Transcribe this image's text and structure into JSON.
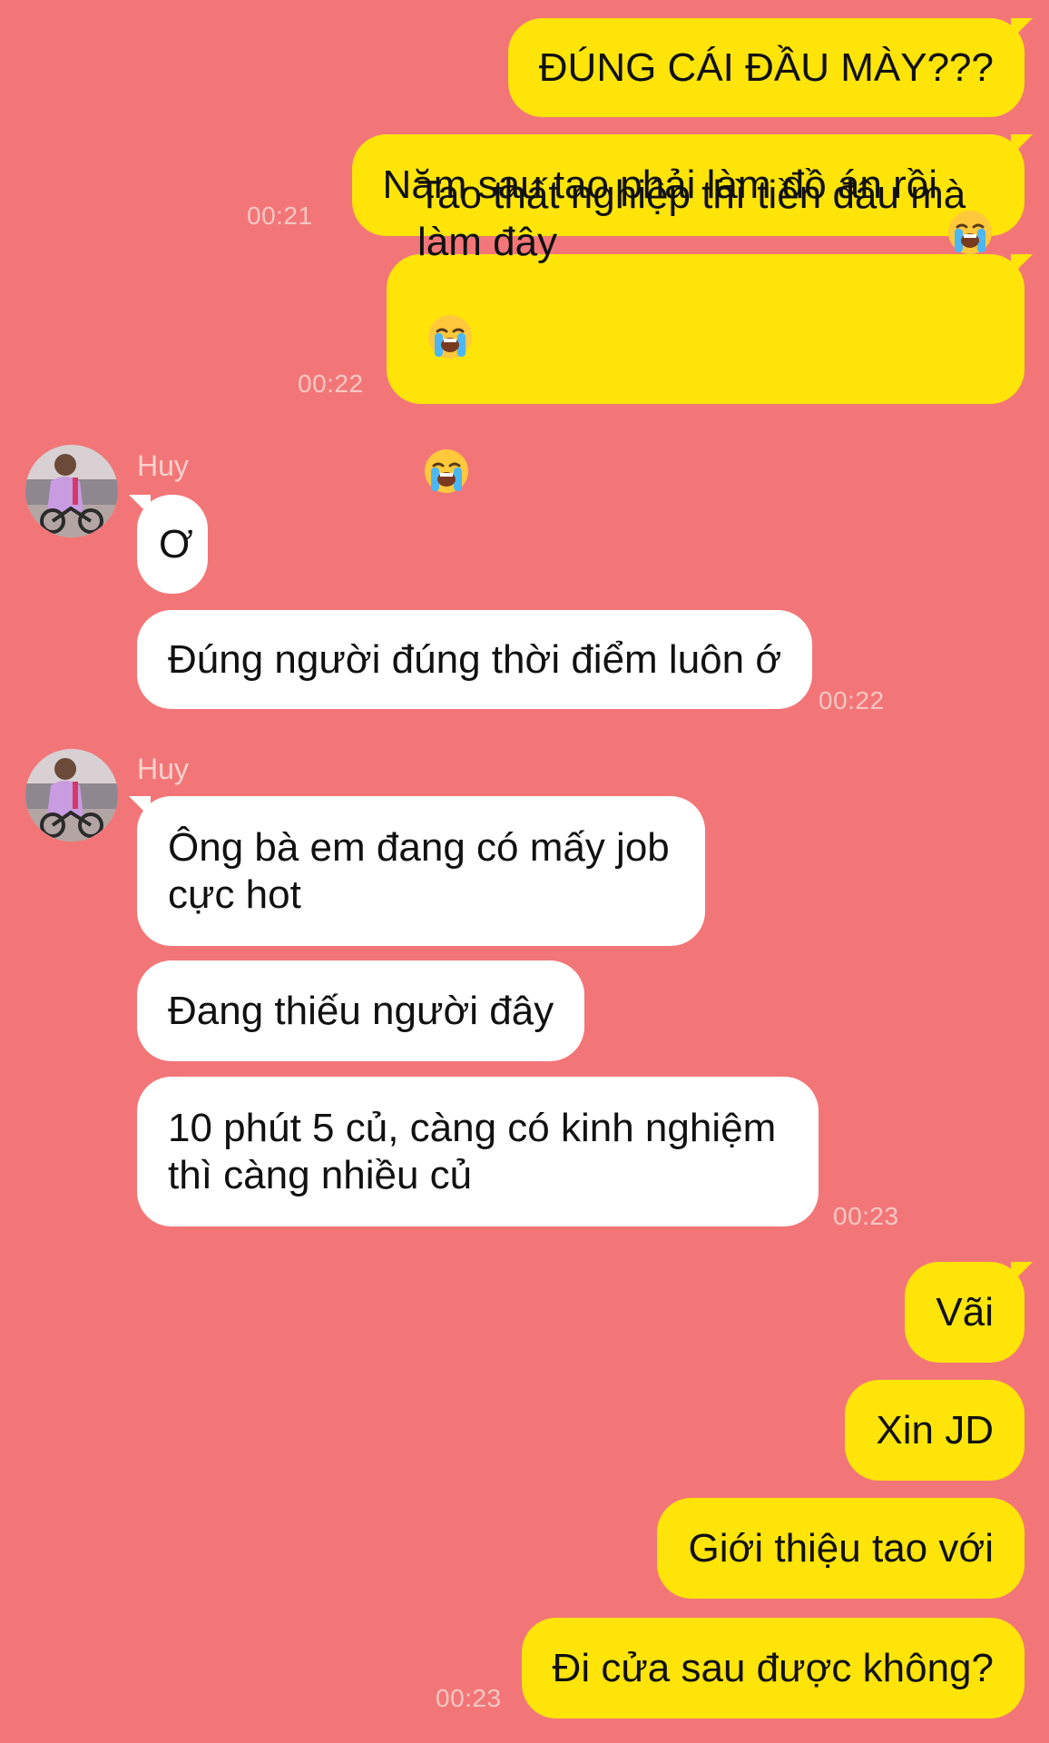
{
  "contact": {
    "name": "Huy"
  },
  "messages": {
    "m1": {
      "text": "ĐÚNG CÁI ĐẦU MÀY???"
    },
    "m2": {
      "text": "Năm sau tao phải làm đồ án rồi",
      "emoji": "loudly-crying-face",
      "time": "00:21"
    },
    "m3": {
      "text": "Tao thất nghiệp thì tiền đâu mà\nlàm đây",
      "emoji": "loudly-crying-face-x2",
      "time": "00:22"
    },
    "g1": {
      "sender": "Huy"
    },
    "m4": {
      "text": "Ơ"
    },
    "m5": {
      "text": "Đúng người đúng thời điểm luôn ớ",
      "time": "00:22"
    },
    "g2": {
      "sender": "Huy"
    },
    "m6": {
      "text": "Ông bà em đang có mấy job\ncực hot"
    },
    "m7": {
      "text": "Đang thiếu người đây"
    },
    "m8": {
      "text": "10 phút 5 củ, càng có kinh nghiệm\nthì càng nhiều củ",
      "time": "00:23"
    },
    "m9": {
      "text": "Vãi"
    },
    "m10": {
      "text": "Xin JD"
    },
    "m11": {
      "text": "Giới thiệu tao với"
    },
    "m12": {
      "text": "Đi cửa sau được không?",
      "time": "00:23"
    }
  },
  "colors": {
    "background": "#F27678",
    "outgoing_bubble": "#FFE40A",
    "incoming_bubble": "#FFFFFF",
    "timestamp": "#F6C7C2"
  }
}
